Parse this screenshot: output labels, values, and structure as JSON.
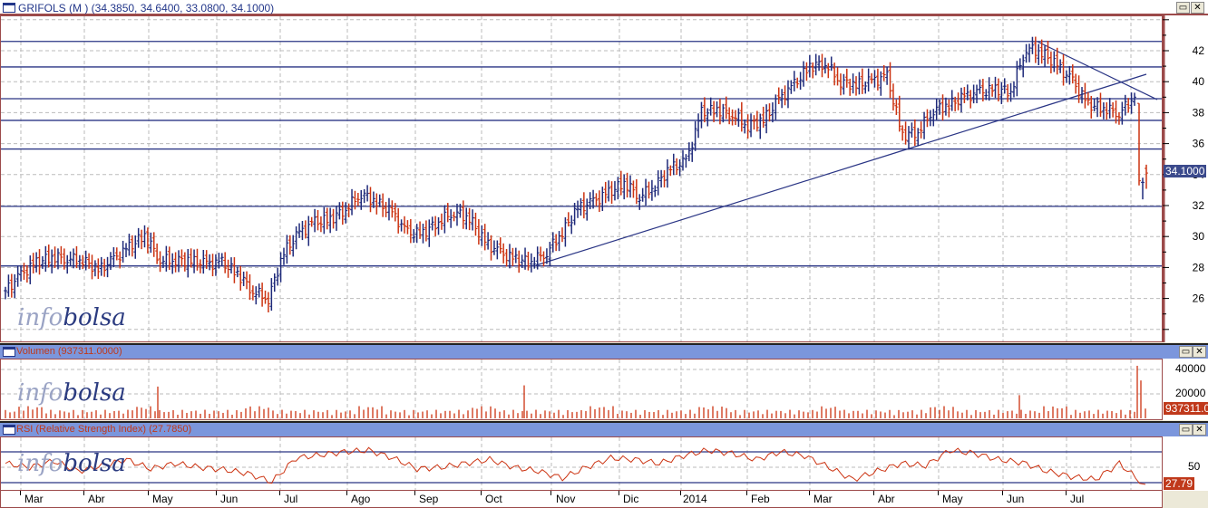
{
  "price_panel": {
    "title": "GRIFOLS (M ) (34.3850, 34.6400, 33.0800, 34.1000)",
    "last_value": "34.1000",
    "y_ticks": [
      26,
      28,
      30,
      32,
      34,
      36,
      38,
      40,
      42
    ],
    "y_range": [
      23.5,
      44.5
    ],
    "y_tick_labels": [
      "26",
      "28",
      "30",
      "32",
      "34",
      "36",
      "38",
      "40",
      "42"
    ],
    "support_resistance_levels": [
      42.6,
      40.95,
      38.9,
      37.5,
      35.65,
      31.95,
      28.1
    ],
    "weekly_closes": [
      26.5,
      27.5,
      28.3,
      28.7,
      28.6,
      28.5,
      27.8,
      28.5,
      29.3,
      30.1,
      28.5,
      28.5,
      28.4,
      28.2,
      28.3,
      27.6,
      26.5,
      26.0,
      29.0,
      30.2,
      30.9,
      31.1,
      31.8,
      32.8,
      32.2,
      31.5,
      30.2,
      30.2,
      31.0,
      31.6,
      31.2,
      29.6,
      28.9,
      28.5,
      28.4,
      29.0,
      30.3,
      31.8,
      32.2,
      32.8,
      33.5,
      32.6,
      33.3,
      34.4,
      34.8,
      38.0,
      38.2,
      37.9,
      37.2,
      37.5,
      38.8,
      39.8,
      41.0,
      41.2,
      40.0,
      39.8,
      40.0,
      40.3,
      36.5,
      36.8,
      38.2,
      38.5,
      39.0,
      39.3,
      39.5,
      39.4,
      42.2,
      41.9,
      41.0,
      40.0,
      38.5,
      38.3,
      38.0,
      39.0,
      33.3,
      34.1
    ],
    "up_color": "#1f2a7a",
    "down_color": "#cc3311"
  },
  "volume_panel": {
    "title": "Volumen (937311.0000)",
    "last_value": "937311.00",
    "y_tick_labels": [
      "20000",
      "40000"
    ],
    "typical_volume": 5000,
    "spikes": [
      {
        "month": "May 2013",
        "value": 26000
      },
      {
        "month": "Oct 2013",
        "value": 27000
      },
      {
        "month": "Jun 2014",
        "value": 19000
      },
      {
        "month": "Jul 2014",
        "value": 43000
      },
      {
        "month": "Jul 2014",
        "value": 31000
      }
    ]
  },
  "rsi_panel": {
    "title": "RSI (Relative Strength Index) (27.7850)",
    "last_value": "27.79",
    "y_tick_labels": [
      "50"
    ],
    "levels": [
      70,
      30
    ],
    "values": [
      55,
      50,
      58,
      45,
      52,
      60,
      48,
      55,
      50,
      47,
      42,
      31,
      62,
      66,
      70,
      72,
      62,
      48,
      50,
      55,
      60,
      50,
      45,
      36,
      50,
      62,
      60,
      55,
      65,
      72,
      68,
      60,
      70,
      65,
      50,
      34,
      45,
      55,
      52,
      72,
      68,
      60,
      56,
      45,
      38,
      34,
      55,
      27.8
    ]
  },
  "x_axis": {
    "months": [
      "Mar",
      "Abr",
      "May",
      "Jun",
      "Jul",
      "Ago",
      "Sep",
      "Oct",
      "Nov",
      "Dic",
      "2014",
      "Feb",
      "Mar",
      "Abr",
      "May",
      "Jun",
      "Jul"
    ]
  },
  "watermark": {
    "part1": "info",
    "part2": "bolsa"
  },
  "window_buttons": {
    "maximize": "▭",
    "close": "✕"
  }
}
